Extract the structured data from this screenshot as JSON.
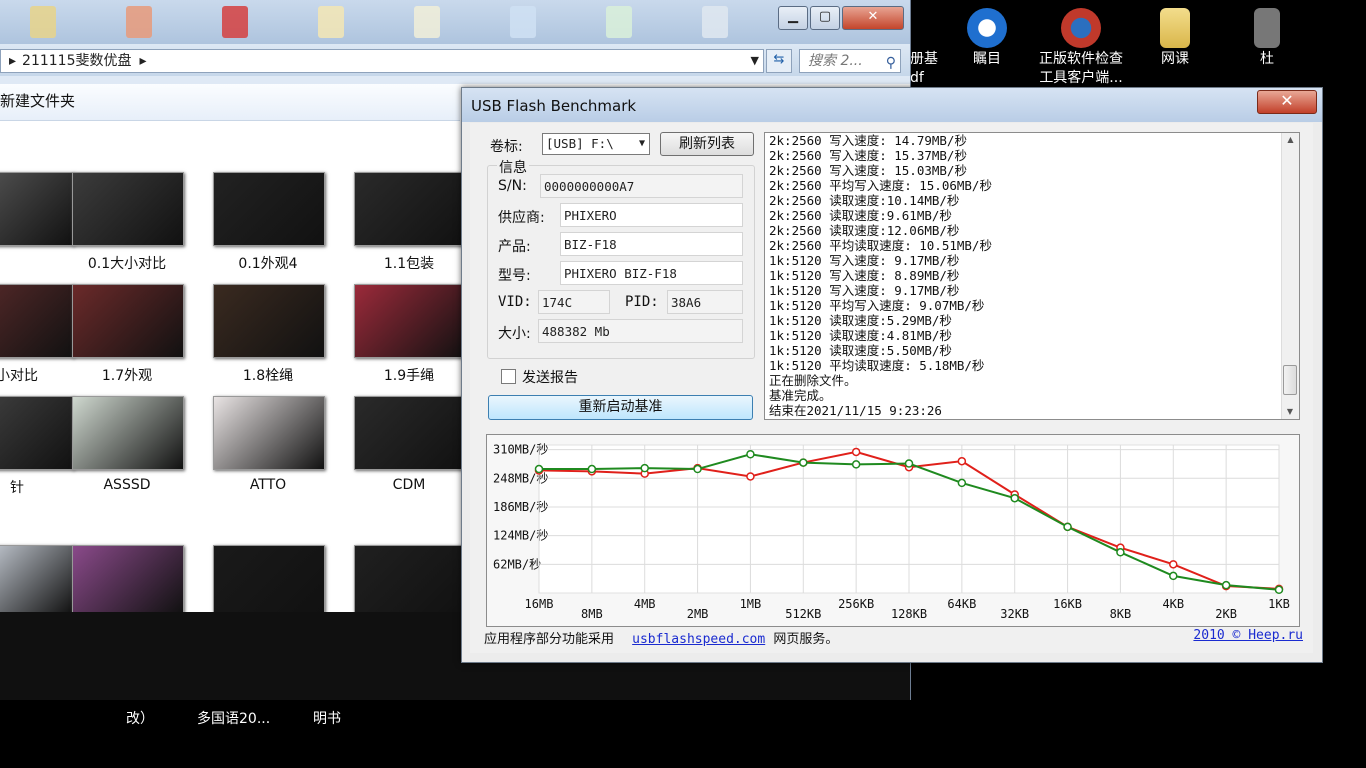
{
  "desktop": {
    "icons": [
      {
        "label": "册基",
        "label2": "df",
        "color": "#3a3a3a"
      },
      {
        "label": "瞩目",
        "label2": "",
        "color": "#1f6fcf"
      },
      {
        "label": "正版软件检查",
        "label2": "工具客户端...",
        "color": "#c0392b"
      },
      {
        "label": "网课",
        "label2": "",
        "color": "#d9b64a"
      },
      {
        "label": "杜",
        "label2": "",
        "color": "#777777"
      }
    ],
    "bottom_labels": [
      "改）",
      "多国语20...",
      "明书"
    ]
  },
  "explorer": {
    "address_path": "211115斐数优盘",
    "search_placeholder": "搜索 2...",
    "folder_title": "新建文件夹",
    "thumbnails": [
      {
        "label": "",
        "color": "#5a5a5a"
      },
      {
        "label": "0.1大小对比",
        "color": "#3c3c3c"
      },
      {
        "label": "0.1外观4",
        "color": "#222222"
      },
      {
        "label": "1.1包装",
        "color": "#2a2a2a"
      },
      {
        "label": "小对比",
        "color": "#5b2b2b"
      },
      {
        "label": "1.7外观",
        "color": "#6b2a2a"
      },
      {
        "label": "1.8栓绳",
        "color": "#3a2a20"
      },
      {
        "label": "1.9手绳",
        "color": "#9b2a3a"
      },
      {
        "label": "针",
        "color": "#444444"
      },
      {
        "label": "ASSSD",
        "color": "#cfd8cf"
      },
      {
        "label": "ATTO",
        "color": "#e9e4e4"
      },
      {
        "label": "CDM",
        "color": "#2a2a2a"
      },
      {
        "label": "",
        "color": "#dfe6f0"
      },
      {
        "label": "",
        "color": "#8a4a8a"
      },
      {
        "label": "",
        "color": "#1a1a1a"
      },
      {
        "label": "",
        "color": "#202020"
      }
    ]
  },
  "bench": {
    "title": "USB Flash Benchmark",
    "close_label": "✕",
    "volume_label": "卷标:",
    "volume_value": "[USB] F:\\",
    "refresh_label": "刷新列表",
    "info_group": "信息",
    "sn_label": "S/N:",
    "sn_value": "0000000000A7",
    "vendor_label": "供应商:",
    "vendor_value": "PHIXERO",
    "product_label": "产品:",
    "product_value": "BIZ-F18",
    "model_label": "型号:",
    "model_value": "PHIXERO BIZ-F18",
    "vid_label": "VID:",
    "vid_value": "174C",
    "pid_label": "PID:",
    "pid_value": "38A6",
    "size_label": "大小:",
    "size_value": "488382 Mb",
    "send_report_label": "发送报告",
    "restart_label": "重新启动基准",
    "log_lines": [
      "2k:2560 写入速度: 14.79MB/秒",
      "2k:2560 写入速度: 15.37MB/秒",
      "2k:2560 写入速度: 15.03MB/秒",
      "2k:2560 平均写入速度: 15.06MB/秒",
      "2k:2560 读取速度:10.14MB/秒",
      "2k:2560 读取速度:9.61MB/秒",
      "2k:2560 读取速度:12.06MB/秒",
      "2k:2560 平均读取速度: 10.51MB/秒",
      "1k:5120 写入速度: 9.17MB/秒",
      "1k:5120 写入速度: 8.89MB/秒",
      "1k:5120 写入速度: 9.17MB/秒",
      "1k:5120 平均写入速度: 9.07MB/秒",
      "1k:5120 读取速度:5.29MB/秒",
      "1k:5120 读取速度:4.81MB/秒",
      "1k:5120 读取速度:5.50MB/秒",
      "1k:5120 平均读取速度: 5.18MB/秒",
      "正在删除文件。",
      "基准完成。",
      "结束在2021/11/15 9:23:26"
    ],
    "status_text": "应用程序部分功能采用",
    "status_link": "usbflashspeed.com",
    "status_text2": "网页服务。",
    "copyright_link": "2010 © Heep.ru"
  },
  "chart_data": {
    "type": "line",
    "categories": [
      "16MB",
      "8MB",
      "4MB",
      "2MB",
      "1MB",
      "512KB",
      "256KB",
      "128KB",
      "64KB",
      "32KB",
      "16KB",
      "8KB",
      "4KB",
      "2KB",
      "1KB"
    ],
    "y_tick_labels": [
      "310MB/秒",
      "248MB/秒",
      "186MB/秒",
      "124MB/秒",
      "62MB/秒"
    ],
    "ylim": [
      0,
      320
    ],
    "grid": true,
    "series": [
      {
        "color": "#e0201a",
        "values": [
          265,
          263,
          258,
          270,
          252,
          282,
          305,
          272,
          285,
          213,
          143,
          98,
          62,
          15,
          9
        ]
      },
      {
        "color": "#1f8a1f",
        "values": [
          268,
          268,
          270,
          268,
          300,
          282,
          278,
          280,
          238,
          205,
          143,
          88,
          37,
          17,
          7
        ]
      }
    ]
  }
}
